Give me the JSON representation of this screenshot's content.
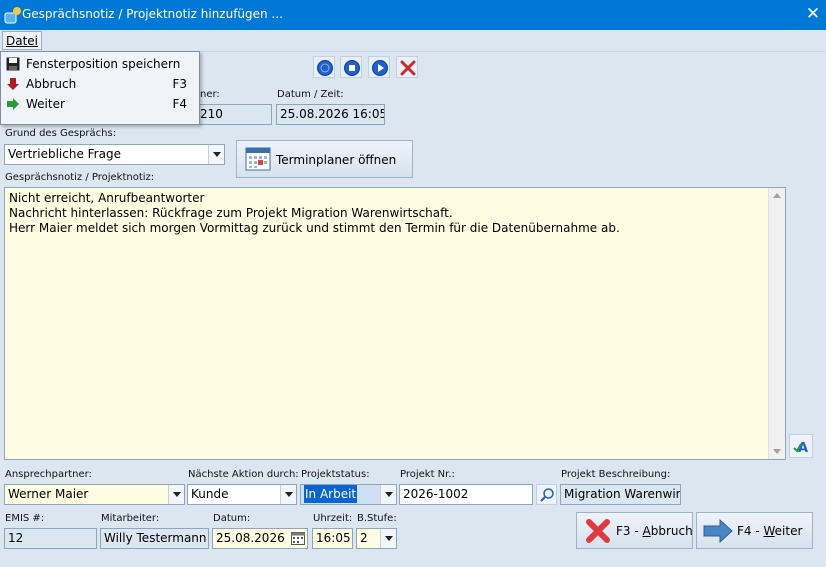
{
  "window": {
    "title": "Gesprächsnotiz / Projektnotiz hinzufügen ..."
  },
  "menu": {
    "datei_label": "Datei",
    "items": [
      {
        "label": "Fensterposition speichern",
        "shortcut": ""
      },
      {
        "label": "Abbruch",
        "shortcut": "F3"
      },
      {
        "label": "Weiter",
        "shortcut": "F4"
      }
    ]
  },
  "header": {
    "partner_label_partial": "ner:",
    "partner_value_partial": "210",
    "datum_zeit_label": "Datum / Zeit:",
    "datum_zeit_value": "25.08.2026 16:05:3"
  },
  "grund": {
    "label": "Grund des Gesprächs:",
    "value": "Vertriebliche Frage",
    "terminplaner_button": "Terminplaner öffnen"
  },
  "notiz": {
    "label": "Gesprächsnotiz / Projektnotiz:",
    "lines": [
      "Nicht erreicht, Anrufbeantworter",
      "Nachricht hinterlassen: Rückfrage zum Projekt Migration Warenwirtschaft.",
      "Herr Maier meldet sich morgen Vormittag zurück und stimmt den Termin für die Datenübernahme ab."
    ]
  },
  "bottom": {
    "ansprechpartner_label": "Ansprechpartner:",
    "ansprechpartner_value": "Werner Maier",
    "naechste_aktion_label": "Nächste Aktion durch:",
    "naechste_aktion_value": "Kunde",
    "projektstatus_label": "Projektstatus:",
    "projektstatus_value": "In Arbeit",
    "projekt_nr_label": "Projekt Nr.:",
    "projekt_nr_value": "2026-1002",
    "projekt_beschreibung_label": "Projekt Beschreibung:",
    "projekt_beschreibung_value": "Migration Warenwirt",
    "emis_label": "EMIS #:",
    "emis_value": "12",
    "mitarbeiter_label": "Mitarbeiter:",
    "mitarbeiter_value": "Willy Testermann",
    "datum_label": "Datum:",
    "datum_value": "25.08.2026",
    "uhrzeit_label": "Uhrzeit:",
    "uhrzeit_value": "16:05",
    "bstufe_label": "B.Stufe:",
    "bstufe_value": "2"
  },
  "buttons": {
    "abbruch_prefix": "F3 - ",
    "abbruch_underlined": "A",
    "abbruch_rest": "bbruch",
    "weiter_prefix": "F4 - ",
    "weiter_underlined": "W",
    "weiter_rest": "eiter"
  },
  "colors": {
    "titlebar": "#0078d7",
    "window_bg": "#dce6f1",
    "notes_bg": "#fffde1",
    "selection": "#0a64d2",
    "cancel_red": "#e0393e",
    "next_blue": "#4a86c5"
  },
  "icons": {
    "toolbar": [
      "record-circle-icon",
      "stop-circle-icon",
      "play-circle-icon",
      "delete-x-icon"
    ],
    "menu": [
      "floppy-disk-icon",
      "arrow-down-red-icon",
      "arrow-right-green-icon"
    ]
  }
}
